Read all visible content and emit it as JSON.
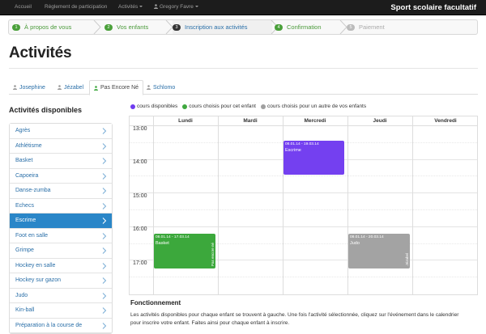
{
  "navbar": {
    "links": [
      "Accueil",
      "Règlement de participation",
      "Activités",
      "Gregory Favre"
    ],
    "brand": "Sport scolaire facultatif"
  },
  "wizard": {
    "steps": [
      {
        "num": "1",
        "label": "À propos de vous",
        "state": "done"
      },
      {
        "num": "2",
        "label": "Vos enfants",
        "state": "done"
      },
      {
        "num": "3",
        "label": "Inscription aux activités",
        "state": "current"
      },
      {
        "num": "4",
        "label": "Confirmation",
        "state": "done"
      },
      {
        "num": "5",
        "label": "Paiement",
        "state": "todo"
      }
    ]
  },
  "page_title": "Activités",
  "tabs": [
    "Josephine",
    "Jézabel",
    "Pas Encore Né",
    "Schlomo"
  ],
  "sidebar": {
    "title": "Activités disponibles",
    "items": [
      "Agrès",
      "Athlétisme",
      "Basket",
      "Capoeira",
      "Danse-zumba",
      "Echecs",
      "Escrime",
      "Foot en salle",
      "Grimpe",
      "Hockey en salle",
      "Hockey sur gazon",
      "Judo",
      "Kin-ball",
      "Préparation à la course de"
    ],
    "active_index": 6
  },
  "legend": [
    {
      "label": "cours disponibles",
      "color": "#6f3cf0"
    },
    {
      "label": "cours choisis pour cet enfant",
      "color": "#3fa83f"
    },
    {
      "label": "cours choisis pour un autre de vos enfants",
      "color": "#a0a0a0"
    }
  ],
  "calendar": {
    "days": [
      "Lundi",
      "Mardi",
      "Mercredi",
      "Jeudi",
      "Vendredi"
    ],
    "times": [
      "13:00",
      "14:00",
      "15:00",
      "16:00",
      "17:00"
    ],
    "events": [
      {
        "date": "08.01.14 - 19.03.14",
        "name": "Escrime",
        "side": "",
        "color": "#7440f0",
        "day": 2
      },
      {
        "date": "08.01.14 - 17.03.14",
        "name": "Basket",
        "side": "Pas encore né",
        "color": "#3ca83c",
        "day": 0
      },
      {
        "date": "08.01.14 - 20.03.14",
        "name": "Judo",
        "side": "Jézabel",
        "color": "#a3a3a3",
        "day": 3
      }
    ]
  },
  "fonctionnement": {
    "title": "Fonctionnement",
    "text": "Les activités disponibles pour chaque enfant se trouvent à gauche. Une fois l'activité sélectionnée, cliquez sur l'événement dans le calendrier pour inscrire votre enfant. Faites ainsi pour chaque enfant à inscrire."
  },
  "colors": {
    "active": "#2a86c8",
    "link": "#2a6fa8",
    "done": "#4aa03a"
  }
}
